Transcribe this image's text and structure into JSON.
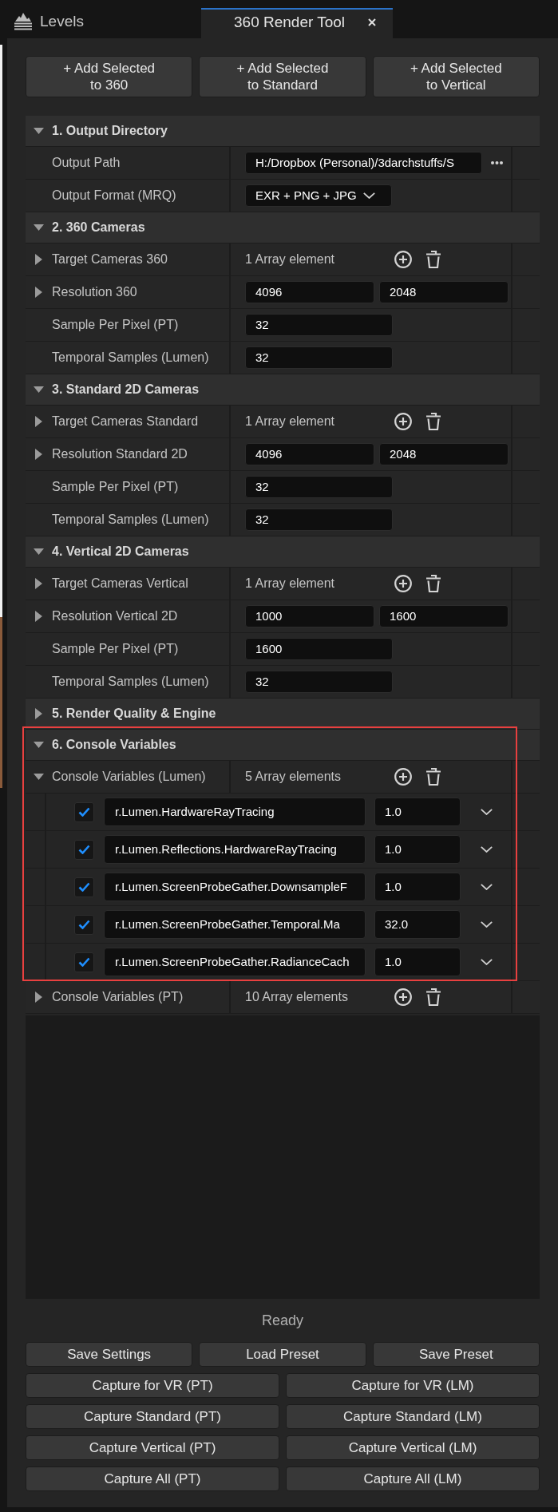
{
  "tabs": [
    {
      "kind": "panel",
      "label": "Levels",
      "selected": false
    },
    {
      "kind": "document",
      "label": "360 Render Tool",
      "selected": true
    }
  ],
  "add_buttons": [
    "+ Add Selected\nto 360",
    "+ Add Selected\nto Standard",
    "+ Add Selected\nto Vertical"
  ],
  "sections": [
    {
      "title": "1. Output Directory",
      "expanded": true,
      "highlighted": false,
      "rows": [
        {
          "kind": "path",
          "label": "Output Path",
          "value": "H:/Dropbox (Personal)/3darchstuffs/S"
        },
        {
          "kind": "dropdown",
          "label": "Output Format (MRQ)",
          "value": "EXR + PNG + JPG"
        }
      ]
    },
    {
      "title": "2. 360 Cameras",
      "expanded": true,
      "highlighted": false,
      "rows": [
        {
          "kind": "array",
          "label": "Target Cameras 360",
          "expanded": false,
          "count": "1 Array element"
        },
        {
          "kind": "pair",
          "label": "Resolution 360",
          "expanded": false,
          "values": [
            "4096",
            "2048"
          ]
        },
        {
          "kind": "number",
          "label": "Sample Per Pixel (PT)",
          "value": "32"
        },
        {
          "kind": "number",
          "label": "Temporal Samples (Lumen)",
          "value": "32"
        }
      ]
    },
    {
      "title": "3. Standard 2D Cameras",
      "expanded": true,
      "highlighted": false,
      "rows": [
        {
          "kind": "array",
          "label": "Target Cameras Standard",
          "expanded": false,
          "count": "1 Array element"
        },
        {
          "kind": "pair",
          "label": "Resolution Standard 2D",
          "expanded": false,
          "values": [
            "4096",
            "2048"
          ]
        },
        {
          "kind": "number",
          "label": "Sample Per Pixel (PT)",
          "value": "32"
        },
        {
          "kind": "number",
          "label": "Temporal Samples (Lumen)",
          "value": "32"
        }
      ]
    },
    {
      "title": "4. Vertical 2D Cameras",
      "expanded": true,
      "highlighted": false,
      "rows": [
        {
          "kind": "array",
          "label": "Target Cameras Vertical",
          "expanded": false,
          "count": "1 Array element"
        },
        {
          "kind": "pair",
          "label": "Resolution Vertical 2D",
          "expanded": false,
          "values": [
            "1000",
            "1600"
          ]
        },
        {
          "kind": "number",
          "label": "Sample Per Pixel (PT)",
          "value": "1600"
        },
        {
          "kind": "number",
          "label": "Temporal Samples (Lumen)",
          "value": "32"
        }
      ]
    },
    {
      "title": "5. Render Quality & Engine",
      "expanded": false,
      "highlighted": false
    },
    {
      "title": "6. Console Variables",
      "expanded": true,
      "highlighted": true,
      "rows": [
        {
          "kind": "array",
          "label": "Console Variables (Lumen)",
          "expanded": true,
          "highlighted": true,
          "count": "5 Array elements",
          "elements": [
            {
              "checked": true,
              "name": "r.Lumen.HardwareRayTracing",
              "value": "1.0"
            },
            {
              "checked": true,
              "name": "r.Lumen.Reflections.HardwareRayTracing",
              "value": "1.0"
            },
            {
              "checked": true,
              "name": "r.Lumen.ScreenProbeGather.DownsampleF",
              "value": "1.0"
            },
            {
              "checked": true,
              "name": "r.Lumen.ScreenProbeGather.Temporal.Ma",
              "value": "32.0"
            },
            {
              "checked": true,
              "name": "r.Lumen.ScreenProbeGather.RadianceCach",
              "value": "1.0"
            }
          ]
        },
        {
          "kind": "array",
          "label": "Console Variables (PT)",
          "expanded": false,
          "highlighted": false,
          "count": "10 Array elements"
        }
      ]
    }
  ],
  "status": "Ready",
  "button_rows": [
    [
      "Save Settings",
      "Load Preset",
      "Save Preset"
    ],
    [
      "Capture for VR (PT)",
      "Capture for VR (LM)"
    ],
    [
      "Capture Standard (PT)",
      "Capture Standard (LM)"
    ],
    [
      "Capture Vertical (PT)",
      "Capture Vertical (LM)"
    ],
    [
      "Capture All (PT)",
      "Capture All (LM)"
    ]
  ]
}
